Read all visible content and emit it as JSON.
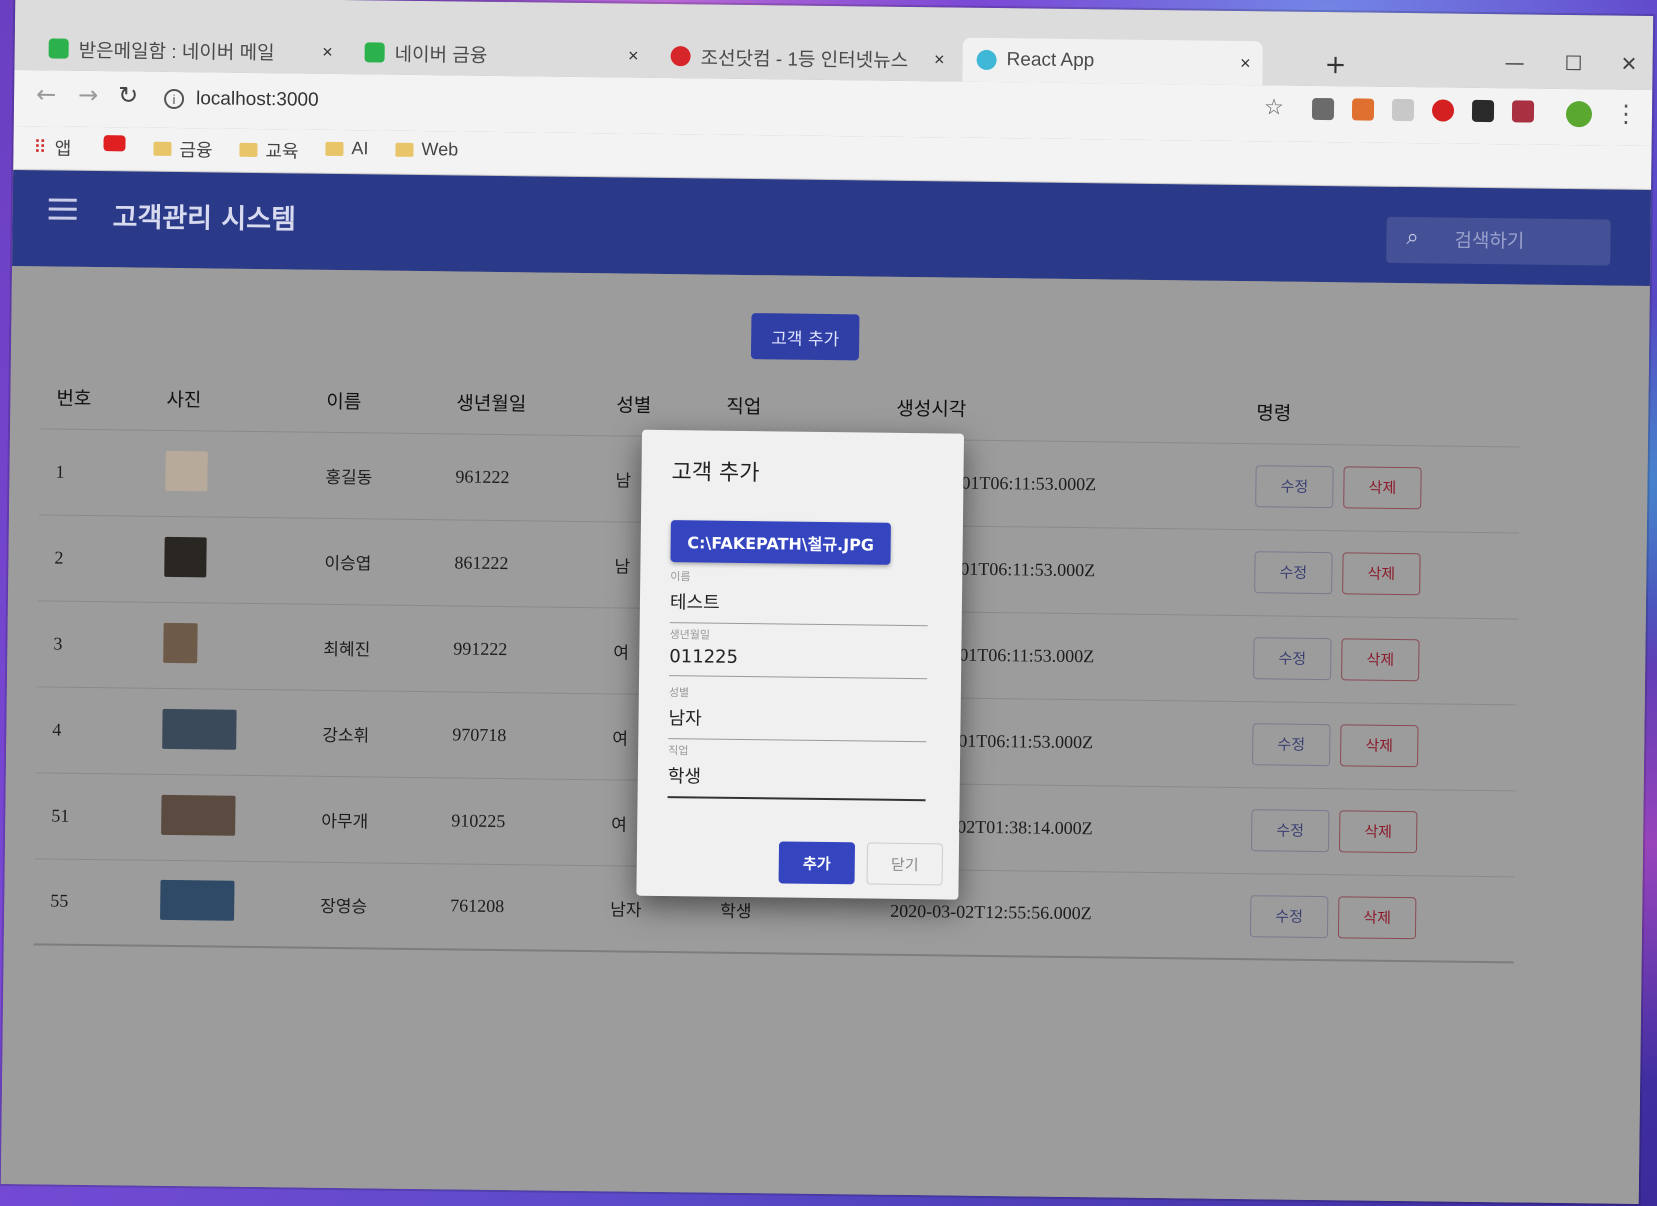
{
  "browser": {
    "tabs": [
      {
        "title": "받은메일함 : 네이버 메일",
        "favicon_color": "#2bb24c"
      },
      {
        "title": "네이버 금융",
        "favicon_color": "#2bb24c"
      },
      {
        "title": "조선닷컴 - 1등 인터넷뉴스",
        "favicon_color": "#d7262a"
      },
      {
        "title": "React App",
        "favicon_color": "#3fb7d6",
        "active": true
      }
    ],
    "tab_close": "×",
    "new_tab": "+",
    "window_controls": {
      "minimize": "—",
      "maximize": "☐",
      "close": "✕"
    },
    "url": "localhost:3000",
    "bookmarks": [
      {
        "label": "앱",
        "icon": "apps-grid-icon"
      },
      {
        "label": "",
        "icon": "youtube-icon"
      },
      {
        "label": "금융",
        "icon": "folder-icon"
      },
      {
        "label": "교육",
        "icon": "folder-icon"
      },
      {
        "label": "AI",
        "icon": "folder-icon"
      },
      {
        "label": "Web",
        "icon": "folder-icon"
      }
    ]
  },
  "app": {
    "title": "고객관리 시스템",
    "search_placeholder": "검색하기",
    "add_button": "고객 추가",
    "columns": [
      "번호",
      "사진",
      "이름",
      "생년월일",
      "성별",
      "직업",
      "생성시각",
      "명령"
    ],
    "rows": [
      {
        "id": "1",
        "name": "홍길동",
        "birthday": "961222",
        "gender": "남",
        "job": "",
        "created": "2020-03-01T06:11:53.000Z",
        "thumb": "#b8aa9a"
      },
      {
        "id": "2",
        "name": "이승엽",
        "birthday": "861222",
        "gender": "남",
        "job": "",
        "created": "2020-03-01T06:11:53.000Z",
        "thumb": "#2a2622"
      },
      {
        "id": "3",
        "name": "최혜진",
        "birthday": "991222",
        "gender": "여",
        "job": "",
        "created": "2020-03-01T06:11:53.000Z",
        "thumb": "#6e5a48"
      },
      {
        "id": "4",
        "name": "강소휘",
        "birthday": "970718",
        "gender": "여",
        "job": "",
        "created": "2020-03-01T06:11:53.000Z",
        "thumb": "#3a4a5a"
      },
      {
        "id": "51",
        "name": "아무개",
        "birthday": "910225",
        "gender": "여",
        "job": "",
        "created": "2020-03-02T01:38:14.000Z",
        "thumb": "#5a4a40"
      },
      {
        "id": "55",
        "name": "장영승",
        "birthday": "761208",
        "gender": "남자",
        "job": "학생",
        "created": "2020-03-02T12:55:56.000Z",
        "thumb": "#2e4a66"
      }
    ],
    "edit_label": "수정",
    "delete_label": "삭제"
  },
  "dialog": {
    "title": "고객 추가",
    "file_button": "C:\\FAKEPATH\\철규.JPG",
    "fields": [
      {
        "label": "이름",
        "value": "테스트"
      },
      {
        "label": "생년월일",
        "value": "011225"
      },
      {
        "label": "성별",
        "value": "남자"
      },
      {
        "label": "직업",
        "value": "학생"
      }
    ],
    "submit": "추가",
    "close": "닫기"
  }
}
